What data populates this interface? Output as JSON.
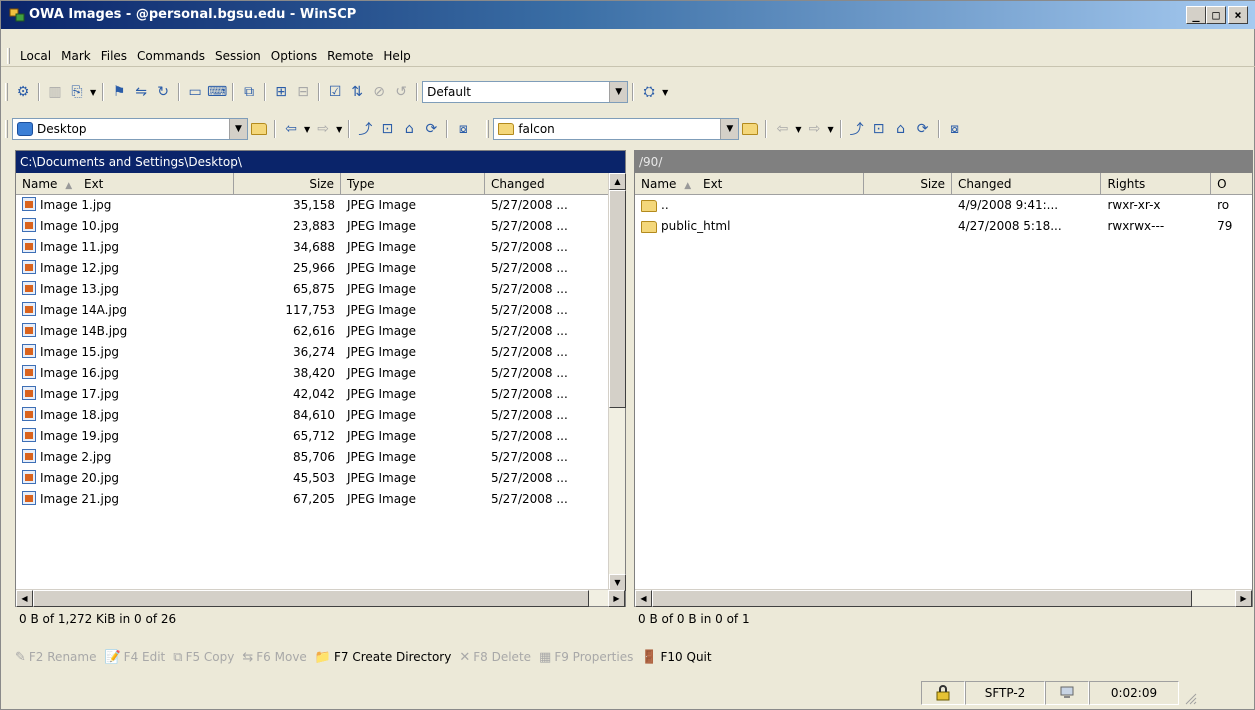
{
  "window": {
    "title": "OWA Images - @personal.bgsu.edu - WinSCP"
  },
  "window_buttons": {
    "minimize": "_",
    "maximize": "□",
    "close": "×"
  },
  "menu": [
    "Local",
    "Mark",
    "Files",
    "Commands",
    "Session",
    "Options",
    "Remote",
    "Help"
  ],
  "toolbar": {
    "transfer_profile": "Default"
  },
  "left": {
    "location": "Desktop",
    "path": "C:\\Documents and Settings\\Desktop\\",
    "columns": [
      "Name",
      "Ext",
      "Size",
      "Type",
      "Changed"
    ],
    "files": [
      {
        "name": "Image 1.jpg",
        "size": "35,158",
        "type": "JPEG Image",
        "changed": "5/27/2008 ..."
      },
      {
        "name": "Image 10.jpg",
        "size": "23,883",
        "type": "JPEG Image",
        "changed": "5/27/2008 ..."
      },
      {
        "name": "Image 11.jpg",
        "size": "34,688",
        "type": "JPEG Image",
        "changed": "5/27/2008 ..."
      },
      {
        "name": "Image 12.jpg",
        "size": "25,966",
        "type": "JPEG Image",
        "changed": "5/27/2008 ..."
      },
      {
        "name": "Image 13.jpg",
        "size": "65,875",
        "type": "JPEG Image",
        "changed": "5/27/2008 ..."
      },
      {
        "name": "Image 14A.jpg",
        "size": "117,753",
        "type": "JPEG Image",
        "changed": "5/27/2008 ..."
      },
      {
        "name": "Image 14B.jpg",
        "size": "62,616",
        "type": "JPEG Image",
        "changed": "5/27/2008 ..."
      },
      {
        "name": "Image 15.jpg",
        "size": "36,274",
        "type": "JPEG Image",
        "changed": "5/27/2008 ..."
      },
      {
        "name": "Image 16.jpg",
        "size": "38,420",
        "type": "JPEG Image",
        "changed": "5/27/2008 ..."
      },
      {
        "name": "Image 17.jpg",
        "size": "42,042",
        "type": "JPEG Image",
        "changed": "5/27/2008 ..."
      },
      {
        "name": "Image 18.jpg",
        "size": "84,610",
        "type": "JPEG Image",
        "changed": "5/27/2008 ..."
      },
      {
        "name": "Image 19.jpg",
        "size": "65,712",
        "type": "JPEG Image",
        "changed": "5/27/2008 ..."
      },
      {
        "name": "Image 2.jpg",
        "size": "85,706",
        "type": "JPEG Image",
        "changed": "5/27/2008 ..."
      },
      {
        "name": "Image 20.jpg",
        "size": "45,503",
        "type": "JPEG Image",
        "changed": "5/27/2008 ..."
      },
      {
        "name": "Image 21.jpg",
        "size": "67,205",
        "type": "JPEG Image",
        "changed": "5/27/2008 ..."
      }
    ],
    "status": "0 B of 1,272 KiB in 0 of 26"
  },
  "right": {
    "location": "falcon",
    "path": "/90/",
    "columns": [
      "Name",
      "Ext",
      "Size",
      "Changed",
      "Rights",
      "O"
    ],
    "files": [
      {
        "name": "..",
        "changed": "4/9/2008 9:41:...",
        "rights": "rwxr-xr-x",
        "owner": "ro"
      },
      {
        "name": "public_html",
        "changed": "4/27/2008 5:18...",
        "rights": "rwxrwx---",
        "owner": "79"
      }
    ],
    "status": "0 B of 0 B in 0 of 1"
  },
  "hotkeys": [
    {
      "label": "F2 Rename",
      "icon": "rename-icon",
      "glyph": "✎",
      "active": false
    },
    {
      "label": "F4 Edit",
      "icon": "edit-icon",
      "glyph": "📝",
      "active": false
    },
    {
      "label": "F5 Copy",
      "icon": "copy-icon",
      "glyph": "⧉",
      "active": false
    },
    {
      "label": "F6 Move",
      "icon": "move-icon",
      "glyph": "⇆",
      "active": false
    },
    {
      "label": "F7 Create Directory",
      "icon": "create-directory-icon",
      "glyph": "📁",
      "active": true
    },
    {
      "label": "F8 Delete",
      "icon": "delete-icon",
      "glyph": "✕",
      "active": false
    },
    {
      "label": "F9 Properties",
      "icon": "properties-icon",
      "glyph": "▦",
      "active": false
    },
    {
      "label": "F10 Quit",
      "icon": "quit-icon",
      "glyph": "🚪",
      "active": true
    }
  ],
  "statusbar": {
    "protocol": "SFTP-2",
    "elapsed": "0:02:09"
  }
}
